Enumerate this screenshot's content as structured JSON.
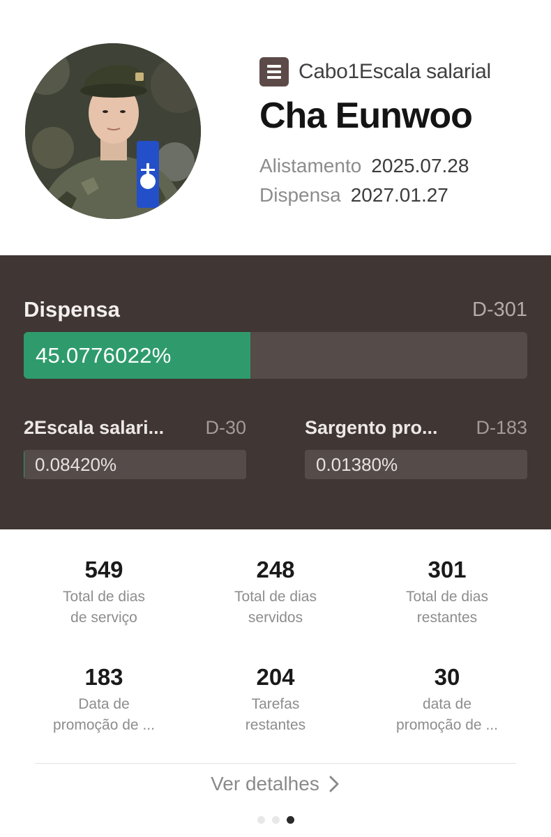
{
  "profile": {
    "rank_label": "Cabo1Escala salarial",
    "name": "Cha Eunwoo",
    "enlist_key": "Alistamento",
    "enlist_value": "2025.07.28",
    "discharge_key": "Dispensa",
    "discharge_value": "2027.01.27",
    "rank_icon": "menu-list-icon",
    "avatar": "profile-photo"
  },
  "progress": {
    "title": "Dispensa",
    "d_day": "D-301",
    "percent_text": "45.0776022%",
    "fill_fraction": 0.450776022,
    "fill_color": "#2f9b6c",
    "items": [
      {
        "title": "2Escala salari...",
        "d_day": "D-30",
        "percent_text": "0.08420%",
        "fill_fraction": 0.000842
      },
      {
        "title": "Sargento pro...",
        "d_day": "D-183",
        "percent_text": "0.01380%",
        "fill_fraction": 0.000138
      }
    ]
  },
  "stats": [
    {
      "value": "549",
      "label_1": "Total de dias",
      "label_2": "de serviço"
    },
    {
      "value": "248",
      "label_1": "Total de dias",
      "label_2": "servidos"
    },
    {
      "value": "301",
      "label_1": "Total de dias",
      "label_2": "restantes"
    },
    {
      "value": "183",
      "label_1": "Data de",
      "label_2": "promoção de ..."
    },
    {
      "value": "204",
      "label_1": "Tarefas",
      "label_2": "restantes"
    },
    {
      "value": "30",
      "label_1": "data de",
      "label_2": "promoção de ..."
    }
  ],
  "footer": {
    "details_label": "Ver detalhes",
    "details_icon": "chevron-right-icon",
    "page_count": 3,
    "active_page": 3
  },
  "colors": {
    "panel_bg": "#403634",
    "accent_green": "#2f9b6c",
    "rank_icon_bg": "#5c4a48"
  }
}
